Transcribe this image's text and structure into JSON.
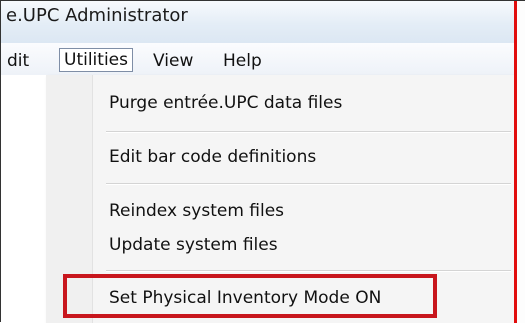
{
  "window": {
    "title": "e.UPC Administrator"
  },
  "menubar": {
    "items": [
      {
        "label": "dit"
      },
      {
        "label": "Utilities"
      },
      {
        "label": "View"
      },
      {
        "label": "Help"
      }
    ]
  },
  "utilities_menu": {
    "items": [
      {
        "label": "Purge entrée.UPC data files"
      },
      {
        "label": "Edit bar code definitions"
      },
      {
        "label": "Reindex system files"
      },
      {
        "label": "Update system files"
      },
      {
        "label": "Set Physical Inventory Mode ON"
      }
    ]
  },
  "colors": {
    "highlight_border": "#c8161d",
    "edge_line": "#e10d0d"
  }
}
